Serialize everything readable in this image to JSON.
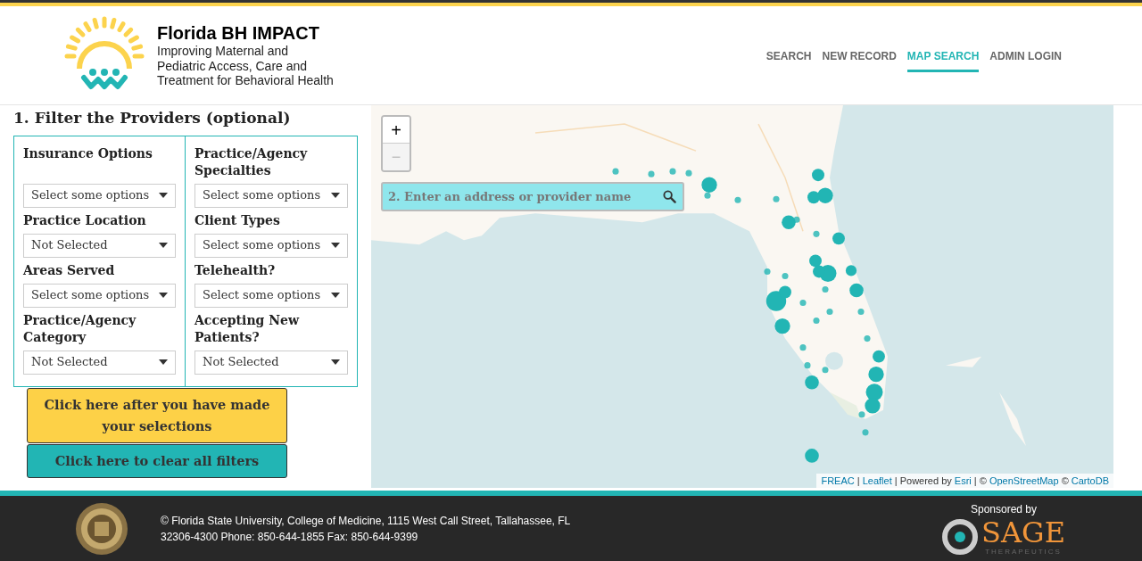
{
  "logo": {
    "title": "Florida BH IMPACT",
    "subtitle": "Improving Maternal and Pediatric Access, Care and Treatment for Behavioral Health"
  },
  "nav": [
    {
      "label": "SEARCH",
      "selected": false
    },
    {
      "label": "NEW RECORD",
      "selected": false
    },
    {
      "label": "MAP SEARCH",
      "selected": true
    },
    {
      "label": "ADMIN LOGIN",
      "selected": false
    }
  ],
  "filter_heading": "1. Filter the Providers (optional)",
  "filters": [
    {
      "label": "Insurance Options",
      "value": "Select some options"
    },
    {
      "label": "Practice/Agency Specialties",
      "value": "Select some options"
    },
    {
      "label": "Practice Location",
      "value": "Not Selected"
    },
    {
      "label": "Client Types",
      "value": "Select some options"
    },
    {
      "label": "Areas Served",
      "value": "Select some options"
    },
    {
      "label": "Telehealth?",
      "value": "Select some options"
    },
    {
      "label": "Practice/Agency Category",
      "value": "Not Selected"
    },
    {
      "label": "Accepting New Patients?",
      "value": "Not Selected"
    }
  ],
  "apply_button": "Click here after you have made your selections",
  "clear_button": "Click here to clear all filters",
  "map": {
    "zoom_in": "+",
    "zoom_out": "−",
    "search": {
      "placeholder": "2. Enter an address or provider name"
    },
    "attribution": [
      {
        "text": "FREAC",
        "link": true
      },
      {
        "text": " | ",
        "link": false
      },
      {
        "text": "Leaflet",
        "link": true
      },
      {
        "text": " | Powered by ",
        "link": false
      },
      {
        "text": "Esri",
        "link": true
      },
      {
        "text": " | © ",
        "link": false
      },
      {
        "text": "OpenStreetMap",
        "link": true
      },
      {
        "text": " © ",
        "link": false
      },
      {
        "text": "CartoDB",
        "link": true
      }
    ]
  },
  "footer": {
    "text": "© Florida State University, College of Medicine, 1115 West Call Street, Tallahassee, FL 32306-4300 Phone: 850-644-1855 Fax: 850-644-9399",
    "sponsor_label": "Sponsored by",
    "sponsor_name": "SAGE",
    "sponsor_sub": "THERAPEUTICS"
  }
}
